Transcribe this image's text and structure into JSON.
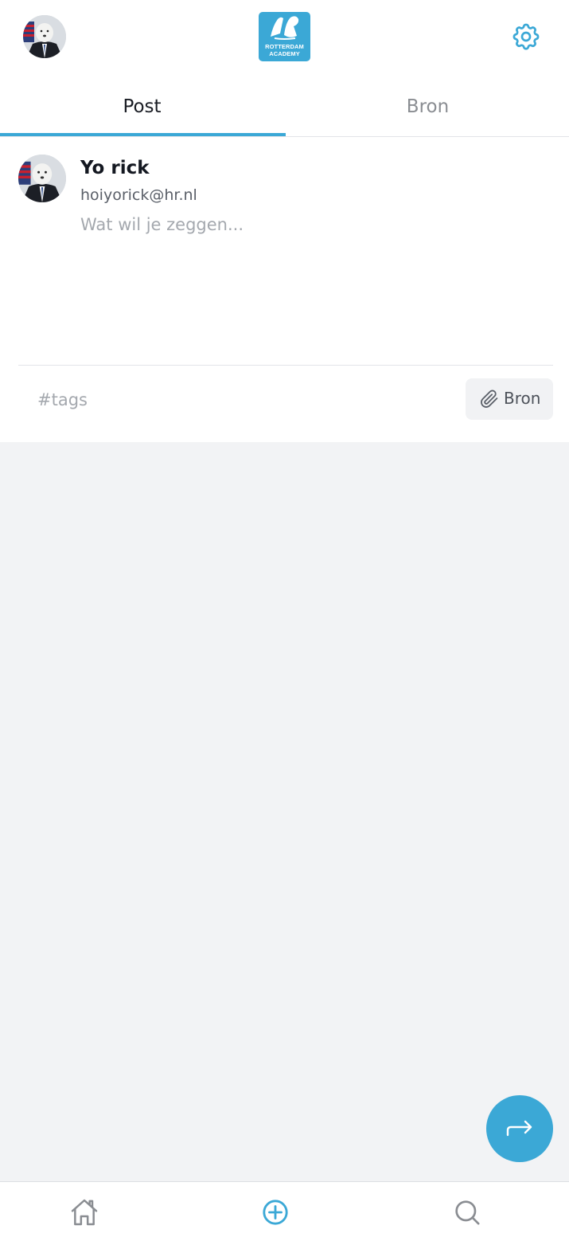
{
  "header": {
    "logo": {
      "line1": "ROTTERDAM",
      "line2": "ACADEMY"
    },
    "icons": {
      "profile": "profile-avatar",
      "settings": "gear-icon"
    }
  },
  "tabs": [
    {
      "label": "Post",
      "active": true
    },
    {
      "label": "Bron",
      "active": false
    }
  ],
  "composer": {
    "user_name": "Yo rick",
    "user_email": "hoiyorick@hr.nl",
    "post_placeholder": "Wat wil je zeggen...",
    "tags_placeholder": "#tags",
    "source_button_label": "Bron",
    "source_button_icon": "paperclip-icon"
  },
  "fab": {
    "icon": "share-arrow-icon"
  },
  "bottom_nav": [
    {
      "icon": "home-icon",
      "active": false
    },
    {
      "icon": "plus-circle-icon",
      "active": true
    },
    {
      "icon": "search-icon",
      "active": false
    }
  ],
  "colors": {
    "accent": "#3ba8d6",
    "background": "#f2f3f5",
    "surface": "#ffffff",
    "muted_text": "#8a8d92"
  }
}
